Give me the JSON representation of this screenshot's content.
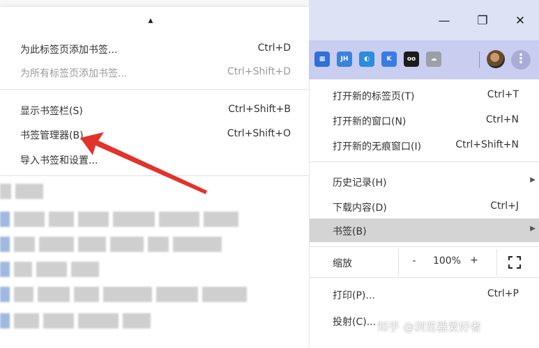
{
  "bookmark_submenu": {
    "scroll_up_glyph": "▲",
    "items": [
      {
        "label": "为此标签页添加书签...",
        "shortcut": "Ctrl+D",
        "enabled": true
      },
      {
        "label": "为所有标签页添加书签...",
        "shortcut": "Ctrl+Shift+D",
        "enabled": false
      },
      {
        "label": "显示书签栏(S)",
        "shortcut": "Ctrl+Shift+B",
        "enabled": true
      },
      {
        "label": "书签管理器(B)",
        "shortcut": "Ctrl+Shift+O",
        "enabled": true
      },
      {
        "label": "导入书签和设置...",
        "shortcut": "",
        "enabled": true
      }
    ]
  },
  "window_controls": {
    "minimize": "—",
    "restore": "❐",
    "close": "✕"
  },
  "extensions": [
    {
      "icon": "grid-extension-icon",
      "text": "▦",
      "color": "#2f6fd6"
    },
    {
      "icon": "jh-extension-icon",
      "text": "JH",
      "color": "#3b82d9"
    },
    {
      "icon": "audio-extension-icon",
      "text": "◐",
      "color": "#2d8be0"
    },
    {
      "icon": "k-extension-icon",
      "text": "K",
      "color": "#3a7be6"
    },
    {
      "icon": "tampermonkey-icon",
      "text": "oo",
      "color": "#1c1c1c"
    },
    {
      "icon": "cloud-extension-icon",
      "text": "☁",
      "color": "#9aa0a6"
    }
  ],
  "main_menu": {
    "items": [
      {
        "label": "打开新的标签页(T)",
        "shortcut": "Ctrl+T"
      },
      {
        "label": "打开新的窗口(N)",
        "shortcut": "Ctrl+N"
      },
      {
        "label": "打开新的无痕窗口(I)",
        "shortcut": "Ctrl+Shift+N"
      },
      {
        "label": "历史记录(H)",
        "shortcut": "",
        "submenu": true
      },
      {
        "label": "下载内容(D)",
        "shortcut": "Ctrl+J"
      },
      {
        "label": "书签(B)",
        "shortcut": "",
        "submenu": true,
        "active": true
      },
      {
        "label": "打印(P)...",
        "shortcut": "Ctrl+P"
      },
      {
        "label": "投射(C)...",
        "shortcut": ""
      }
    ],
    "zoom": {
      "label": "缩放",
      "minus": "-",
      "value": "100%",
      "plus": "+"
    },
    "submenu_arrow": "▶"
  },
  "watermark": "知乎 @浏览器爱好者",
  "colors": {
    "arrow": "#e3322b",
    "titlebar": "#dde2f5",
    "toolbar": "#c9cdf0",
    "active_item": "#d4d4d4"
  }
}
